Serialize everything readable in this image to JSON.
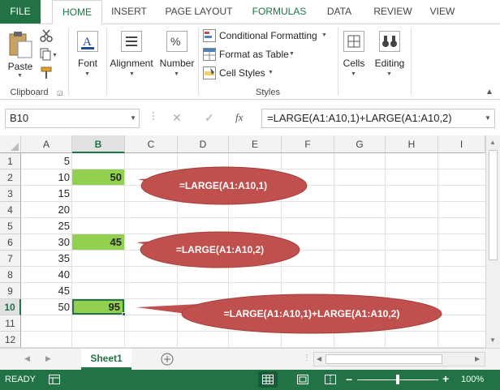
{
  "tabs": [
    "FILE",
    "HOME",
    "INSERT",
    "PAGE LAYOUT",
    "FORMULAS",
    "DATA",
    "REVIEW",
    "VIEW"
  ],
  "ribbon": {
    "clipboard": {
      "paste_label": "Paste",
      "group_label": "Clipboard"
    },
    "font_label": "Font",
    "alignment_label": "Alignment",
    "number_label": "Number",
    "styles": {
      "conditional": "Conditional Formatting",
      "format_table": "Format as Table",
      "cell_styles": "Cell Styles",
      "group_label": "Styles"
    },
    "cells_label": "Cells",
    "editing_label": "Editing"
  },
  "formula_bar": {
    "name_box": "B10",
    "fx": "fx",
    "formula": "=LARGE(A1:A10,1)+LARGE(A1:A10,2)"
  },
  "columns": [
    "A",
    "B",
    "C",
    "D",
    "E",
    "F",
    "G",
    "H",
    "I"
  ],
  "rows": [
    "1",
    "2",
    "3",
    "4",
    "5",
    "6",
    "7",
    "8",
    "9",
    "10",
    "11",
    "12"
  ],
  "col_a": [
    "5",
    "10",
    "15",
    "20",
    "25",
    "30",
    "35",
    "40",
    "45",
    "50",
    "",
    ""
  ],
  "col_b": {
    "r2": "50",
    "r6": "45",
    "r10": "95"
  },
  "callouts": [
    "=LARGE(A1:A10,1)",
    "=LARGE(A1:A10,2)",
    "=LARGE(A1:A10,1)+LARGE(A1:A10,2)"
  ],
  "colors": {
    "highlight": "#92d050",
    "callout": "#c0504d",
    "excel_green": "#217346"
  },
  "sheet_tab": "Sheet1",
  "status": {
    "ready": "READY",
    "zoom": "100%"
  }
}
